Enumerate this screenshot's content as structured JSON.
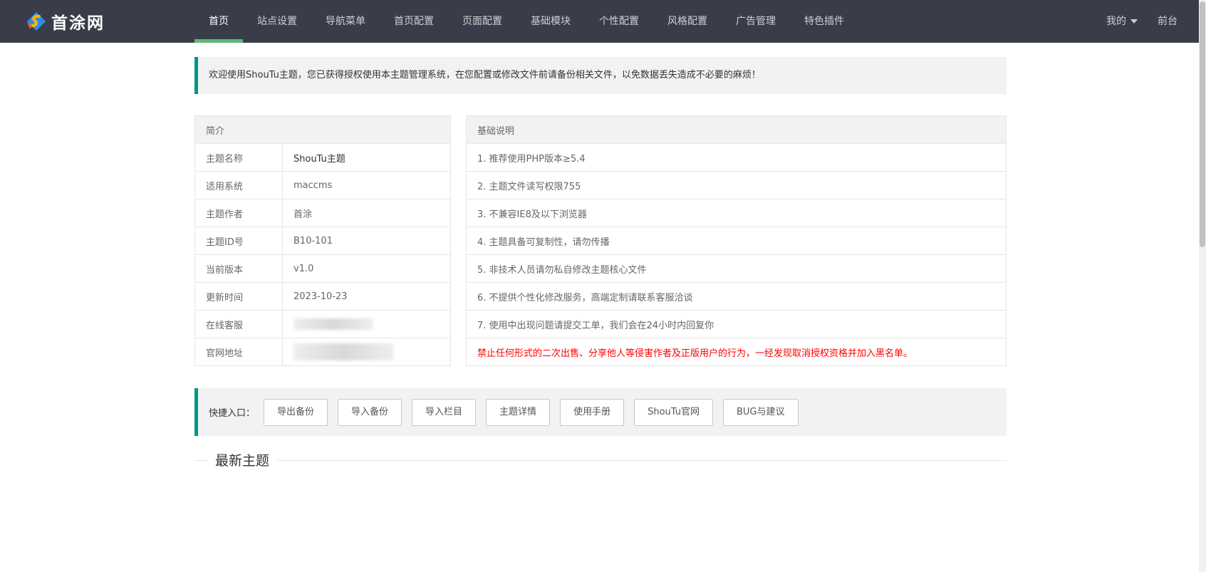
{
  "header": {
    "logo_text": "首涂网",
    "nav": [
      "首页",
      "站点设置",
      "导航菜单",
      "首页配置",
      "页面配置",
      "基础模块",
      "个性配置",
      "风格配置",
      "广告管理",
      "特色插件"
    ],
    "right": {
      "mine": "我的",
      "front": "前台"
    }
  },
  "notice": "欢迎使用ShouTu主题，您已获得授权使用本主题管理系统，在您配置或修改文件前请备份相关文件，以免数据丢失造成不必要的麻烦！",
  "intro": {
    "title": "简介",
    "rows": [
      {
        "k": "主题名称",
        "v": "ShouTu主题"
      },
      {
        "k": "适用系统",
        "v": "maccms"
      },
      {
        "k": "主题作者",
        "v": "首涂"
      },
      {
        "k": "主题ID号",
        "v": "B10-101"
      },
      {
        "k": "当前版本",
        "v": "v1.0"
      },
      {
        "k": "更新时间",
        "v": "2023-10-23"
      },
      {
        "k": "在线客服",
        "v": ""
      },
      {
        "k": "官网地址",
        "v": ""
      }
    ]
  },
  "basic": {
    "title": "基础说明",
    "rows": [
      "1. 推荐使用PHP版本≥5.4",
      "2. 主题文件读写权限755",
      "3. 不兼容IE8及以下浏览器",
      "4. 主题具备可复制性，请勿传播",
      "5. 非技术人员请勿私自修改主题核心文件",
      "6. 不提供个性化修改服务，高端定制请联系客服洽谈",
      "7. 使用中出现问题请提交工单，我们会在24小时内回复你",
      "禁止任何形式的二次出售、分享他人等侵害作者及正版用户的行为，一经发现取消授权资格并加入黑名单。"
    ]
  },
  "quick": {
    "label": "快捷入口：",
    "buttons": [
      "导出备份",
      "导入备份",
      "导入栏目",
      "主题详情",
      "使用手册",
      "ShouTu官网",
      "BUG与建议"
    ]
  },
  "section_title": "最新主题",
  "colors": {
    "header_bg": "#393d49",
    "accent_green": "#5fb878",
    "notice_border": "#009688",
    "warning": "#ff0000"
  }
}
